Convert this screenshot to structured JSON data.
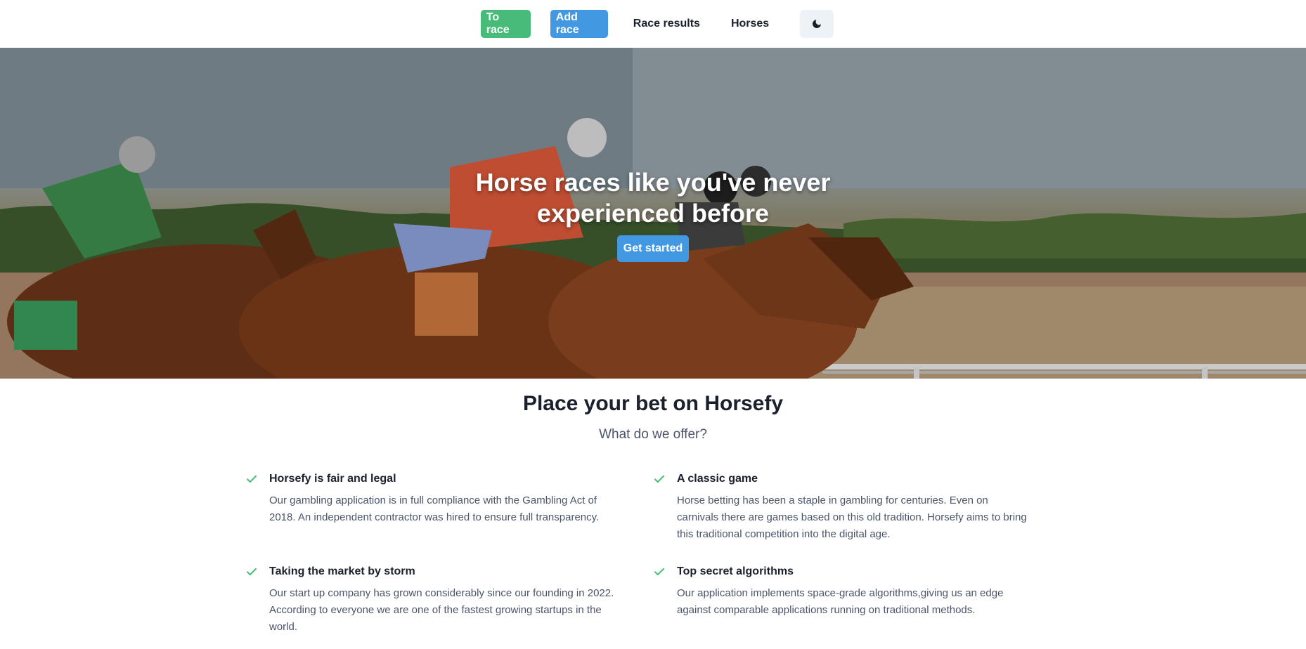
{
  "nav": {
    "to_race": "To race",
    "add_race": "Add race",
    "race_results": "Race results",
    "horses": "Horses",
    "theme_icon": "moon-icon"
  },
  "hero": {
    "title": "Horse races like you've never experienced before",
    "cta": "Get started"
  },
  "features": {
    "title": "Place your bet on Horsefy",
    "subtitle": "What do we offer?",
    "items": [
      {
        "title": "Horsefy is fair and legal",
        "text": "Our gambling application is in full compliance with the Gambling Act of 2018. An independent contractor was hired to ensure full transparency."
      },
      {
        "title": "A classic game",
        "text": "Horse betting has been a staple in gambling for centuries. Even on carnivals there are games based on this old tradition. Horsefy aims to bring this traditional competition into the digital age."
      },
      {
        "title": "Taking the market by storm",
        "text": "Our start up company has grown considerably since our founding in 2022. According to everyone we are one of the fastest growing startups in the world."
      },
      {
        "title": "Top secret algorithms",
        "text": "Our application implements space-grade algorithms,giving us an edge against comparable applications running on traditional methods."
      }
    ]
  },
  "colors": {
    "green": "#48bb78",
    "blue": "#4299e1",
    "check": "#48bb78"
  }
}
